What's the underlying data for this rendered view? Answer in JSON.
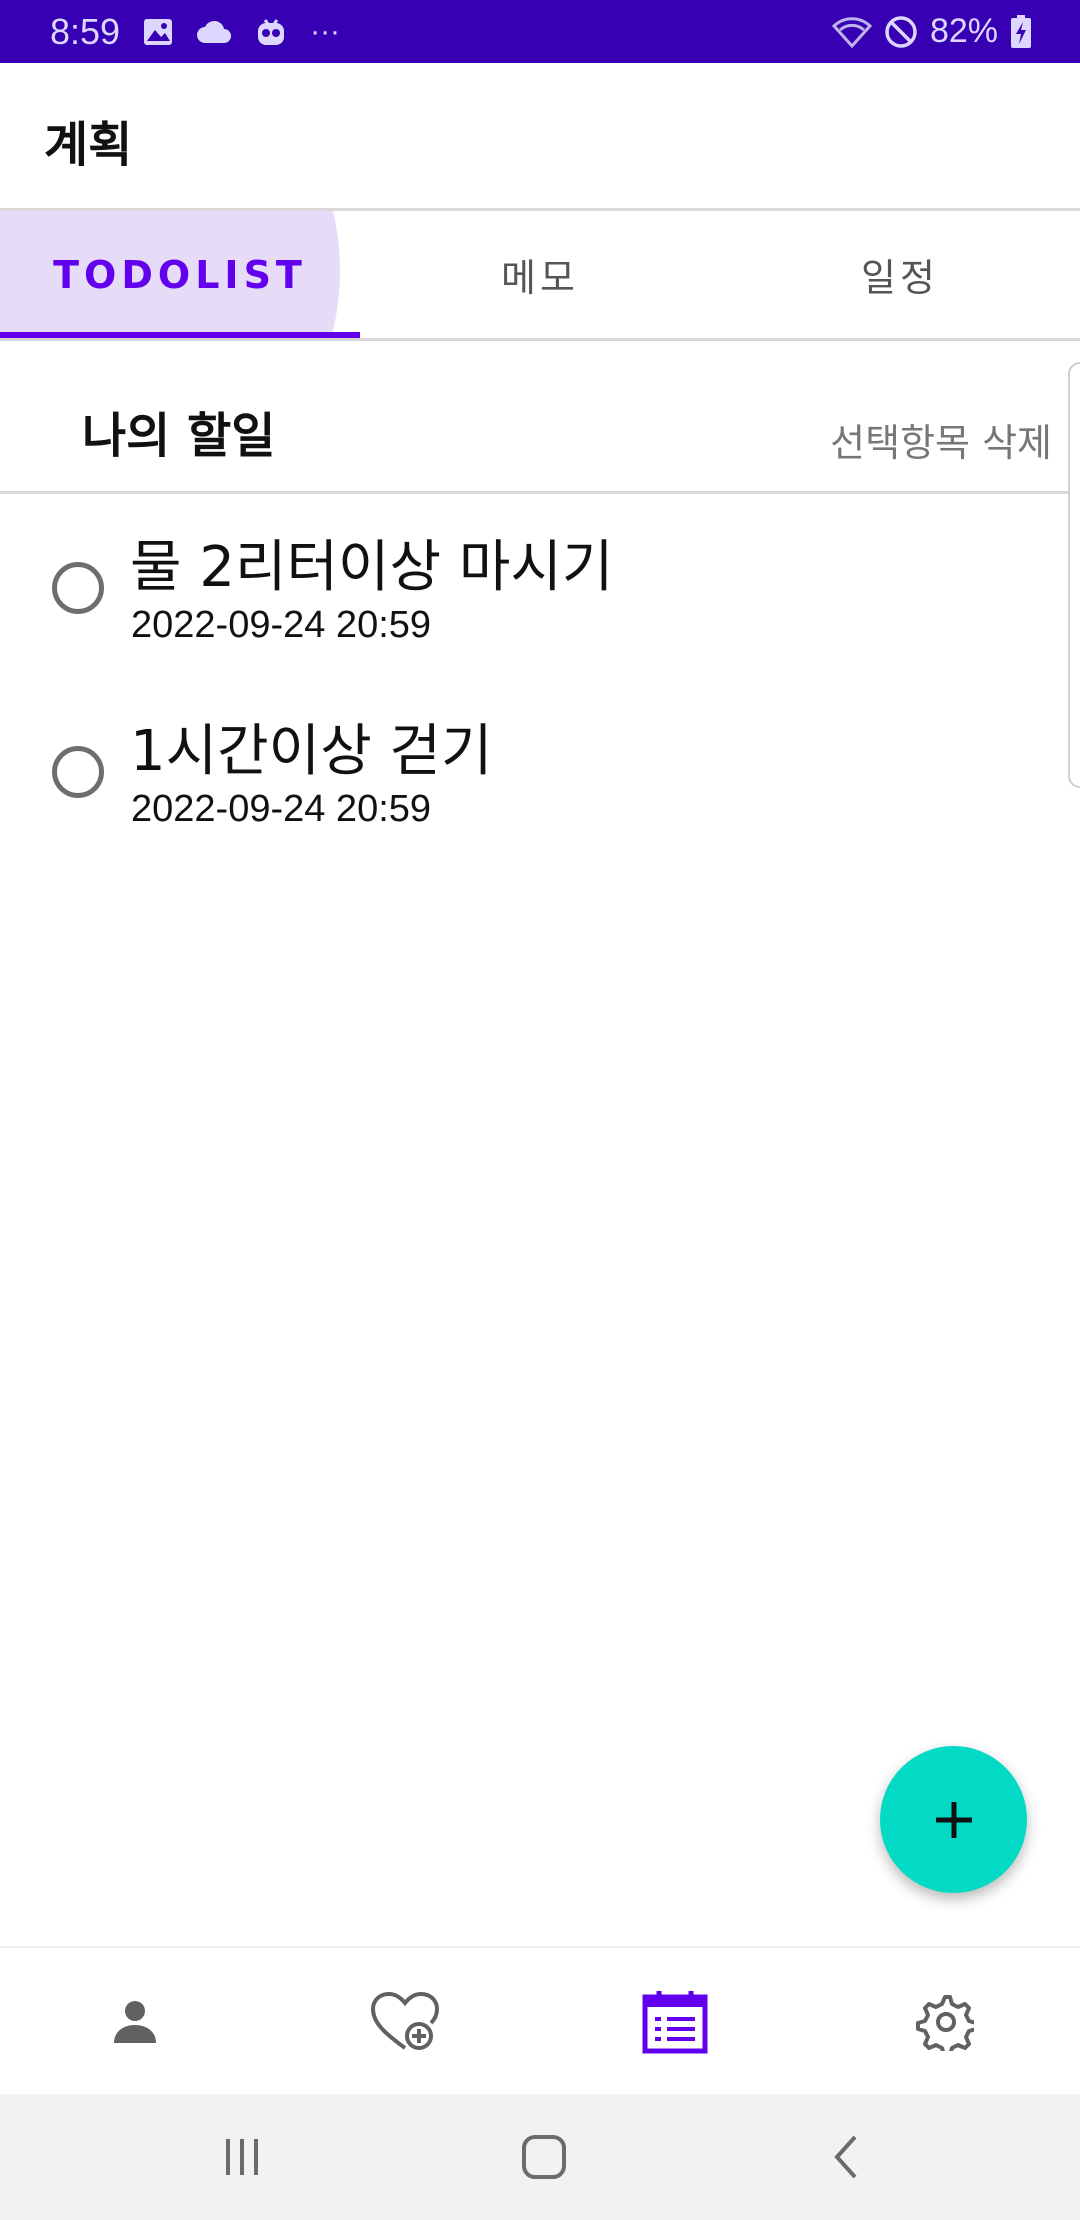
{
  "status_bar": {
    "time": "8:59",
    "battery": "82%",
    "more": "···",
    "color": "#3700b3",
    "left_icons": [
      "gallery-icon",
      "cloud-icon",
      "bot-icon",
      "more-icon"
    ],
    "right_icons": [
      "wifi-icon",
      "do-not-disturb-icon",
      "battery-charging-icon"
    ]
  },
  "app_bar": {
    "title": "계획"
  },
  "tabs": [
    {
      "label": "TODOLIST",
      "selected": true
    },
    {
      "label": "메모",
      "selected": false
    },
    {
      "label": "일정",
      "selected": false
    }
  ],
  "section": {
    "title": "나의 할일",
    "delete_label": "선택항목 삭제"
  },
  "todos": [
    {
      "title": "물 2리터이상 마시기",
      "date": "2022-09-24 20:59",
      "checked": false
    },
    {
      "title": "1시간이상 걷기",
      "date": "2022-09-24 20:59",
      "checked": false
    }
  ],
  "fab": {
    "icon": "plus-icon",
    "color": "#03dac5"
  },
  "bottom_nav": [
    {
      "icon": "person-icon",
      "selected": false
    },
    {
      "icon": "heart-plus-icon",
      "selected": false
    },
    {
      "icon": "calendar-list-icon",
      "selected": true
    },
    {
      "icon": "gear-icon",
      "selected": false
    }
  ],
  "accent_color": "#6200ee",
  "system_nav": [
    "recent-apps-icon",
    "home-icon",
    "back-icon"
  ]
}
